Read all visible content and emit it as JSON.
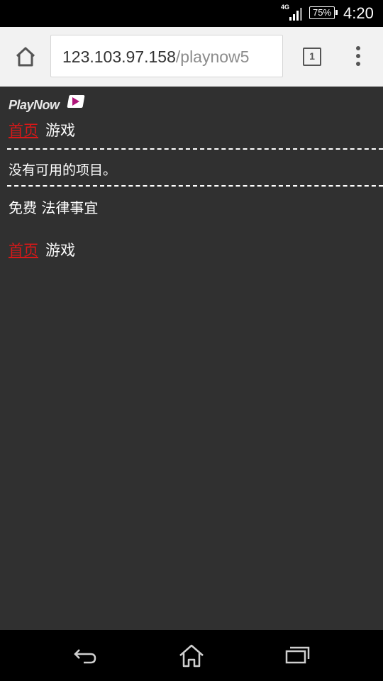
{
  "status_bar": {
    "network": "4G",
    "battery": "75%",
    "time": "4:20"
  },
  "browser": {
    "url_host": "123.103.97.158",
    "url_path": "/playnow5",
    "tab_count": "1"
  },
  "page": {
    "logo_text": "PlayNow",
    "nav_top": {
      "home_link": "首页",
      "games_label": "游戏"
    },
    "empty_message": "没有可用的项目。",
    "footer_links": "免费 法律事宜",
    "nav_bottom": {
      "home_link": "首页",
      "games_label": "游戏"
    }
  },
  "icons": {
    "home": "home-icon",
    "menu": "overflow-menu-icon",
    "back": "back-icon",
    "recents": "recents-icon"
  },
  "colors": {
    "link": "#d81818",
    "background": "#303030",
    "toolbar": "#f2f2f2"
  }
}
